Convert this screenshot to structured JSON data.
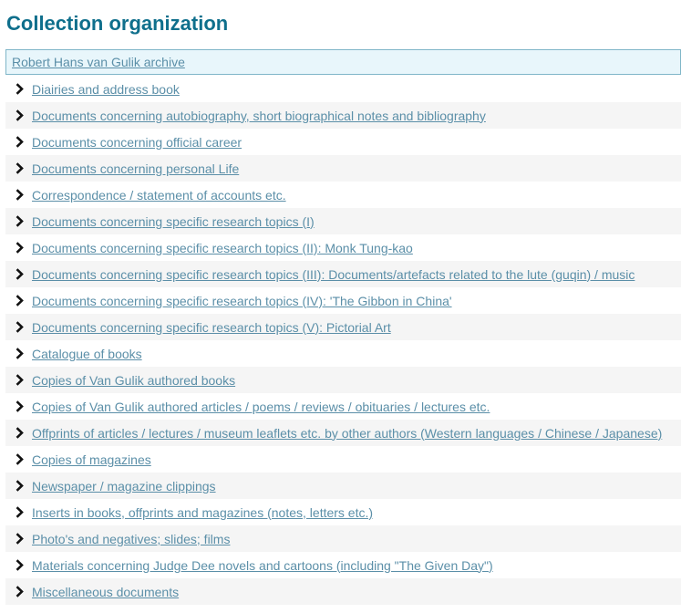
{
  "page": {
    "title": "Collection organization"
  },
  "tree": {
    "root_label": "Robert Hans van Gulik archive",
    "expand_icon": "chevron-right-icon",
    "link_color": "#5b8fa8",
    "heading_color": "#0f6f8c",
    "items": [
      {
        "label": "Diairies and address book"
      },
      {
        "label": "Documents concerning autobiography, short biographical notes and bibliography"
      },
      {
        "label": "Documents concerning official career"
      },
      {
        "label": "Documents concerning personal Life"
      },
      {
        "label": "Correspondence / statement of accounts etc."
      },
      {
        "label": "Documents concerning specific research topics (I)"
      },
      {
        "label": "Documents concerning specific research topics (II): Monk Tung-kao"
      },
      {
        "label": "Documents concerning specific research topics (III): Documents/artefacts related to the lute (guqin) / music"
      },
      {
        "label": "Documents concerning specific research topics (IV): 'The Gibbon in China'"
      },
      {
        "label": "Documents concerning specific research topics (V): Pictorial Art"
      },
      {
        "label": "Catalogue of books"
      },
      {
        "label": "Copies of Van Gulik authored books"
      },
      {
        "label": "Copies of Van Gulik authored articles / poems / reviews / obituaries / lectures etc."
      },
      {
        "label": "Offprints of articles / lectures / museum leaflets etc. by other authors (Western languages / Chinese / Japanese)"
      },
      {
        "label": "Copies of magazines"
      },
      {
        "label": "Newspaper / magazine clippings"
      },
      {
        "label": "Inserts in books, offprints and magazines (notes, letters etc.)"
      },
      {
        "label": "Photo's and negatives; slides; films"
      },
      {
        "label": "Materials concerning Judge Dee novels and cartoons (including \"The Given Day\")"
      },
      {
        "label": "Miscellaneous documents"
      }
    ]
  }
}
